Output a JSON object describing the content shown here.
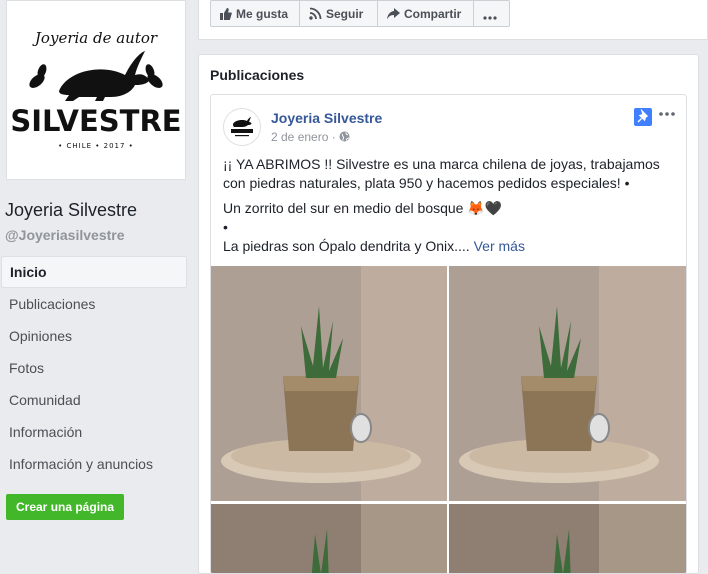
{
  "page": {
    "name": "Joyeria Silvestre",
    "handle": "@Joyeriasilvestre",
    "logo": {
      "line1": "Joyeria de autor",
      "brand": "SILVESTRE",
      "bottom": "• CHILE • 2017 •"
    }
  },
  "nav": {
    "items": [
      {
        "label": "Inicio"
      },
      {
        "label": "Publicaciones"
      },
      {
        "label": "Opiniones"
      },
      {
        "label": "Fotos"
      },
      {
        "label": "Comunidad"
      },
      {
        "label": "Información"
      },
      {
        "label": "Información y anuncios"
      }
    ]
  },
  "create_page": "Crear una página",
  "actions": {
    "like": "Me gusta",
    "follow": "Seguir",
    "share": "Compartir"
  },
  "section": {
    "title": "Publicaciones"
  },
  "post": {
    "author": "Joyeria Silvestre",
    "date": "2 de enero",
    "separator": "·",
    "text1": "¡¡ YA ABRIMOS !! Silvestre es una marca chilena de joyas, trabajamos con piedras naturales, plata 950 y hacemos pedidos especiales! •",
    "text2": "Un zorrito del sur en medio del bosque 🦊🖤",
    "text3": "•",
    "text4": "La piedras son Ópalo dendrita y Onix....",
    "see_more": "Ver más"
  },
  "icons": {
    "like": "thumbs-up-icon",
    "follow": "rss-icon",
    "share": "share-arrow-icon",
    "more": "more-dots-icon",
    "pin": "pin-icon",
    "globe": "globe-icon"
  },
  "colors": {
    "link": "#365899",
    "green": "#42b72a",
    "pin": "#4080ff"
  }
}
